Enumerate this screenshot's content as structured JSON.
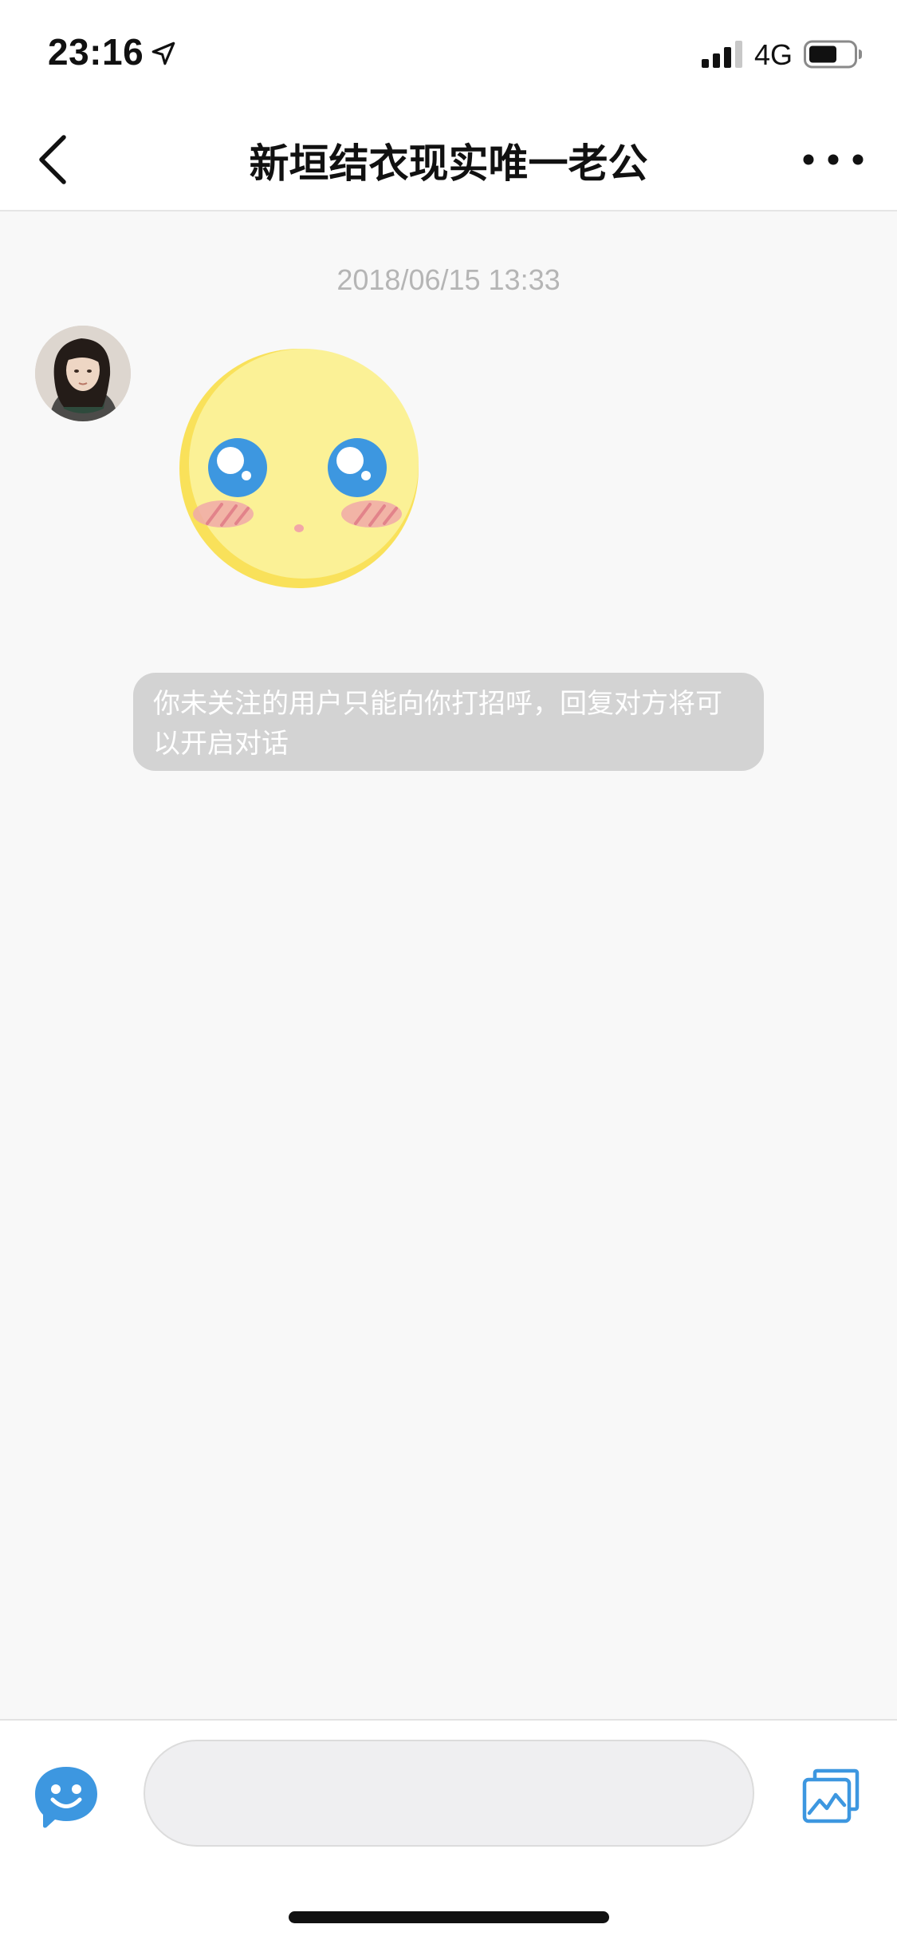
{
  "status_bar": {
    "time": "23:16",
    "network": "4G",
    "icons": [
      "location-arrow-icon",
      "cellular-signal-icon",
      "battery-icon"
    ]
  },
  "nav": {
    "title": "新垣结衣现实唯一老公",
    "back_icon": "chevron-left-icon",
    "more_icon": "more-horizontal-icon"
  },
  "chat": {
    "timestamp": "2018/06/15 13:33",
    "messages": [
      {
        "sender": "contact",
        "type": "sticker",
        "sticker_icon": "blushing-face-sticker"
      }
    ],
    "system_notice": "你未关注的用户只能向你打招呼，回复对方将可以开启对话"
  },
  "input_bar": {
    "emoji_icon": "emoji-face-icon",
    "input_value": "",
    "input_placeholder": "",
    "image_icon": "image-gallery-icon"
  },
  "colors": {
    "accent_blue": "#3d97e0",
    "notice_bg": "#d3d3d3",
    "page_bg": "#f8f8f8",
    "sticker_yellow": "#fbf196"
  }
}
